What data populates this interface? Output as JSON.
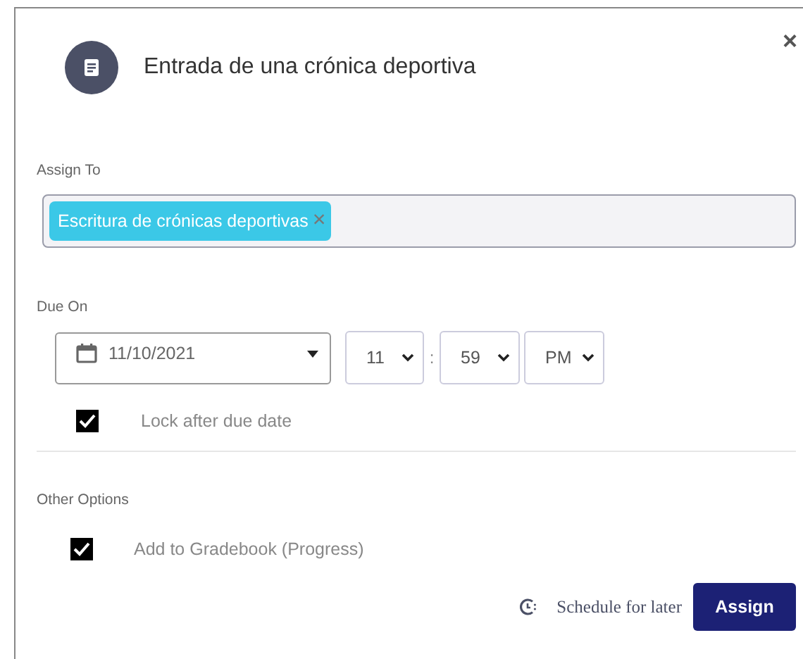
{
  "dialog": {
    "title": "Entrada de una crónica deportiva",
    "close": "×"
  },
  "assign_to": {
    "label": "Assign To",
    "chips": [
      {
        "text": "Escritura de crónicas deportivas",
        "remove": "×"
      }
    ]
  },
  "due_on": {
    "label": "Due On",
    "date": "11/10/2021",
    "hour": "11",
    "separator": ":",
    "minute": "59",
    "ampm": "PM"
  },
  "lock": {
    "label": "Lock after due date",
    "checked": true
  },
  "other_options": {
    "label": "Other Options",
    "items": [
      {
        "label": "Add to Gradebook (Progress)",
        "checked": true
      }
    ]
  },
  "footer": {
    "schedule": "Schedule for later",
    "assign": "Assign"
  }
}
